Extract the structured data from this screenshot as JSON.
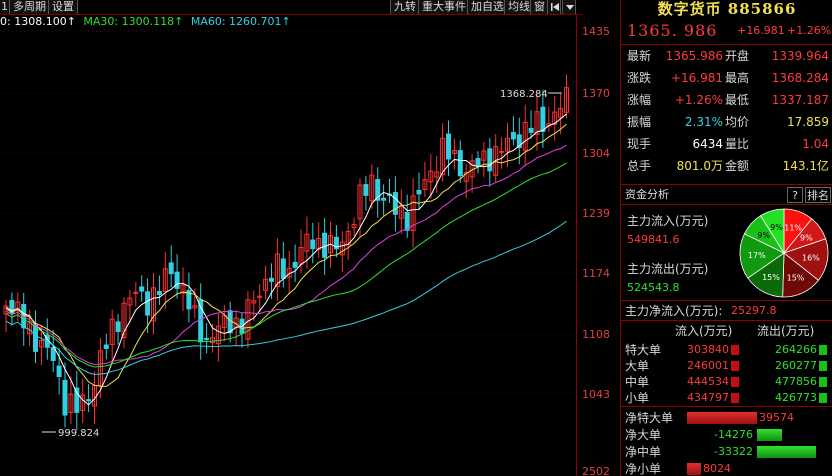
{
  "toolbar": {
    "left": [
      "1日",
      "多周期",
      "设置"
    ],
    "right": [
      "九转",
      "重大事件",
      "加自选",
      "均线",
      "窗"
    ]
  },
  "ma_legend": [
    {
      "label": "0: 1308.100↑",
      "color": "#ffffff"
    },
    {
      "label": "MA30: 1300.118↑",
      "color": "#2ee02e"
    },
    {
      "label": "MA60: 1260.701↑",
      "color": "#34d0e0"
    }
  ],
  "chart_data": {
    "type": "candlestick",
    "y_ticks": [
      "1435",
      "1370",
      "1304",
      "1239",
      "1174",
      "1108",
      "1043",
      "2502"
    ],
    "annotations": {
      "high": "1368.284",
      "low": "999.824"
    }
  },
  "panel": {
    "title": "数字货币 885866",
    "price": "1365. 986",
    "change": "+16.981",
    "change_pct": "+1.26%",
    "quotes": [
      {
        "l1": "最新",
        "v1": "1365.986",
        "c1": "red",
        "l2": "开盘",
        "v2": "1339.964",
        "c2": "red"
      },
      {
        "l1": "涨跌",
        "v1": "+16.981",
        "c1": "red",
        "l2": "最高",
        "v2": "1368.284",
        "c2": "red"
      },
      {
        "l1": "涨幅",
        "v1": "+1.26%",
        "c1": "red",
        "l2": "最低",
        "v2": "1337.187",
        "c2": "red"
      },
      {
        "l1": "振幅",
        "v1": "2.31%",
        "c1": "cyan",
        "l2": "均价",
        "v2": "17.859",
        "c2": "yellow"
      },
      {
        "l1": "现手",
        "v1": "6434",
        "c1": "white",
        "l2": "量比",
        "v2": "1.04",
        "c2": "red"
      },
      {
        "l1": "总手",
        "v1": "801.0万",
        "c1": "yellow",
        "l2": "金额",
        "v2": "143.1亿",
        "c2": "yellow"
      }
    ],
    "fund_analysis": {
      "title": "资金分析",
      "help": "?",
      "rank": "排名"
    },
    "main_in": {
      "label": "主力流入(万元)",
      "value": "549841.6"
    },
    "main_out": {
      "label": "主力流出(万元)",
      "value": "524543.8"
    },
    "main_net": {
      "label": "主力净流入(万元):",
      "value": "25297.8"
    },
    "pie": [
      "11%",
      "9%",
      "16%",
      "15%",
      "15%",
      "17%",
      "9%",
      "9%"
    ],
    "flow": {
      "in_header": "流入(万元)",
      "out_header": "流出(万元)",
      "rows": [
        {
          "label": "特大单",
          "in": "303840",
          "out": "264266"
        },
        {
          "label": "大单",
          "in": "246001",
          "out": "260277"
        },
        {
          "label": "中单",
          "in": "444534",
          "out": "477856"
        },
        {
          "label": "小单",
          "in": "434797",
          "out": "426773"
        }
      ]
    },
    "net": [
      {
        "label": "净特大单",
        "value": "39574",
        "dir": "pos"
      },
      {
        "label": "净大单",
        "value": "-14276",
        "dir": "neg"
      },
      {
        "label": "净中单",
        "value": "-33322",
        "dir": "neg"
      },
      {
        "label": "净小单",
        "value": "8024",
        "dir": "pos"
      }
    ]
  }
}
